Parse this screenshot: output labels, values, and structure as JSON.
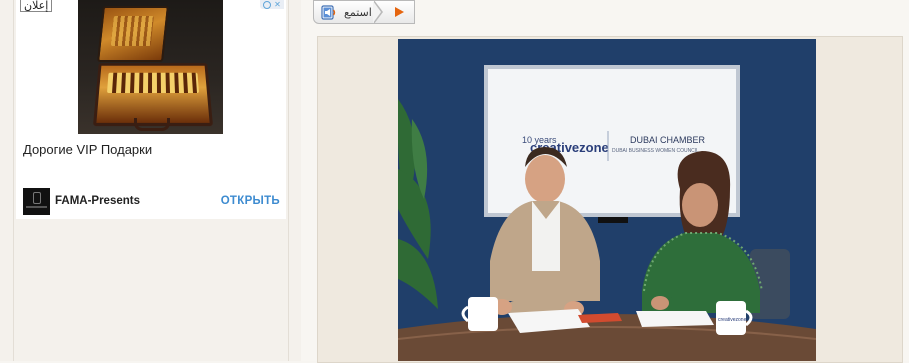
{
  "ad": {
    "label": "إعلان",
    "title": "Дорогие VIP Подарки",
    "brand": "FAMA-Presents",
    "cta": "ОТКРЫТЬ",
    "choices_icon": "info-icon"
  },
  "listen": {
    "label": "استمع",
    "play_icon": "play-icon",
    "speaker_icon": "speaker-icon"
  },
  "photo": {
    "screen_left_text": "creativezone",
    "screen_left_sup": "10 years",
    "screen_right_title": "DUBAI CHAMBER",
    "screen_right_sub": "DUBAI BUSINESS WOMEN COUNCIL",
    "mug_text": "creativezone"
  },
  "colors": {
    "accent": "#3d8bd0",
    "play": "#e5650f",
    "wall": "#23436f"
  }
}
